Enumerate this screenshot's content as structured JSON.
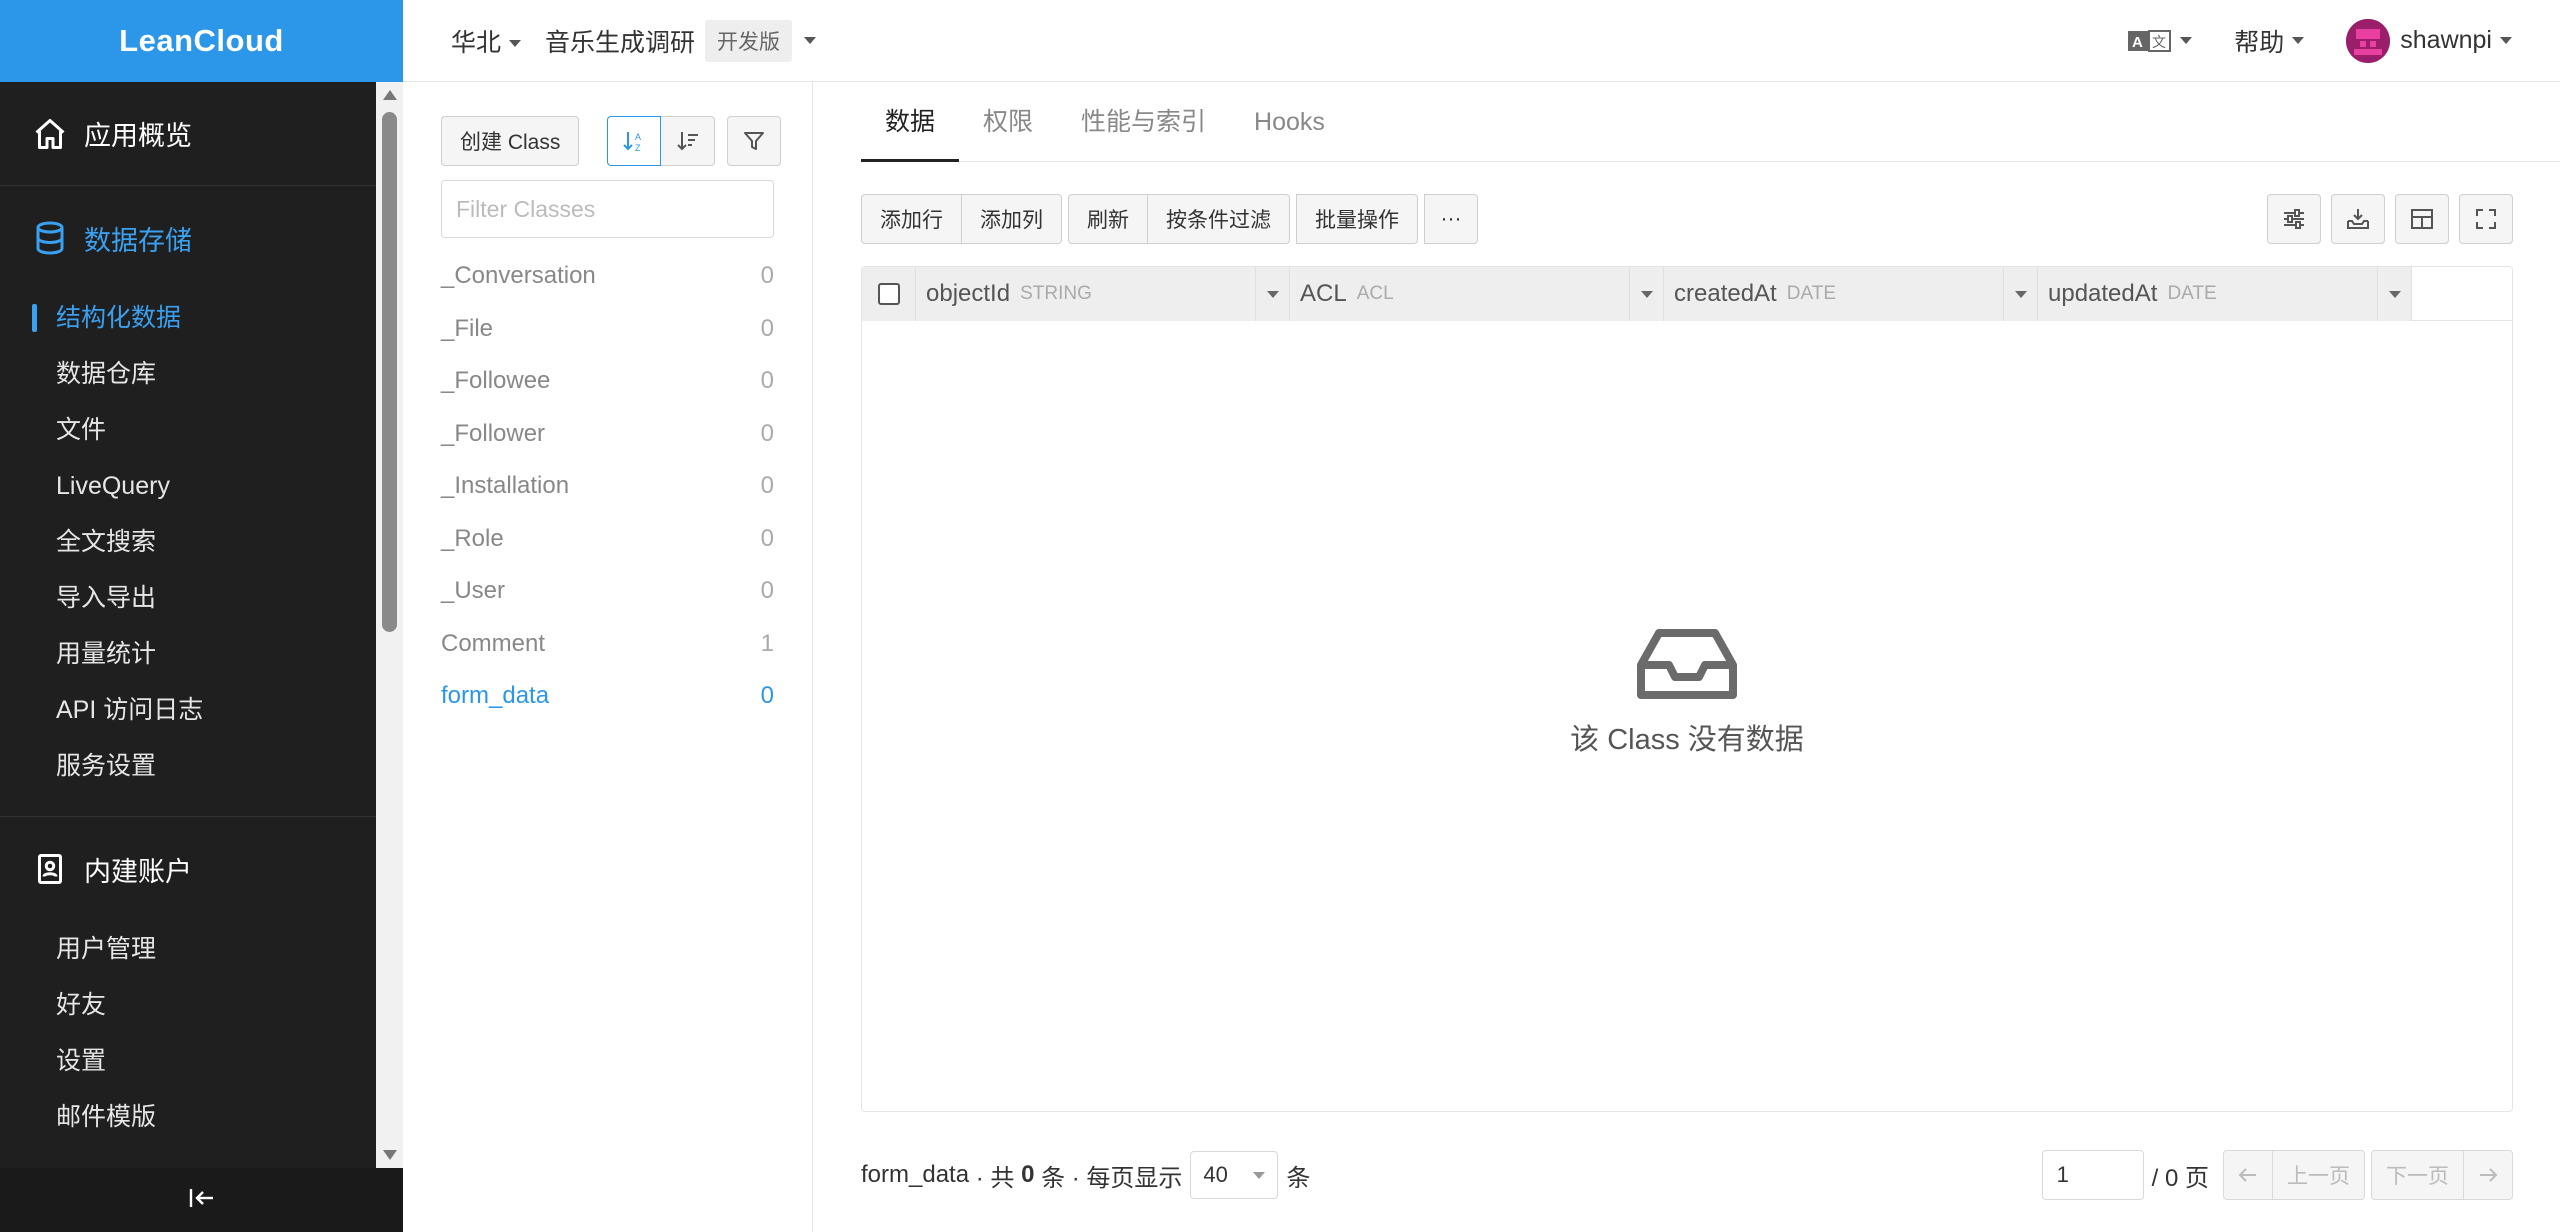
{
  "brand": "LeanCloud",
  "sidebar": {
    "overview": "应用概览",
    "storage": "数据存储",
    "storage_items": [
      {
        "label": "结构化数据"
      },
      {
        "label": "数据仓库"
      },
      {
        "label": "文件"
      },
      {
        "label": "LiveQuery"
      },
      {
        "label": "全文搜索"
      },
      {
        "label": "导入导出"
      },
      {
        "label": "用量统计"
      },
      {
        "label": "API 访问日志"
      },
      {
        "label": "服务设置"
      }
    ],
    "accounts": "内建账户",
    "account_items": [
      {
        "label": "用户管理"
      },
      {
        "label": "好友"
      },
      {
        "label": "设置"
      },
      {
        "label": "邮件模版"
      }
    ]
  },
  "topbar": {
    "region": "华北",
    "app_name": "音乐生成调研",
    "plan": "开发版",
    "help": "帮助",
    "user": "shawnpi"
  },
  "classes": {
    "create_label": "创建 Class",
    "filter_placeholder": "Filter Classes",
    "items": [
      {
        "name": "_Conversation",
        "count": "0"
      },
      {
        "name": "_File",
        "count": "0"
      },
      {
        "name": "_Followee",
        "count": "0"
      },
      {
        "name": "_Follower",
        "count": "0"
      },
      {
        "name": "_Installation",
        "count": "0"
      },
      {
        "name": "_Role",
        "count": "0"
      },
      {
        "name": "_User",
        "count": "0"
      },
      {
        "name": "Comment",
        "count": "1"
      },
      {
        "name": "form_data",
        "count": "0"
      }
    ]
  },
  "tabs": [
    "数据",
    "权限",
    "性能与索引",
    "Hooks"
  ],
  "actions": {
    "add_row": "添加行",
    "add_col": "添加列",
    "refresh": "刷新",
    "filter": "按条件过滤",
    "batch": "批量操作",
    "more": "···"
  },
  "columns": [
    {
      "name": "objectId",
      "type": "STRING"
    },
    {
      "name": "ACL",
      "type": "ACL"
    },
    {
      "name": "createdAt",
      "type": "DATE"
    },
    {
      "name": "updatedAt",
      "type": "DATE"
    }
  ],
  "empty_text": "该 Class 没有数据",
  "footer": {
    "class_name": "form_data",
    "sep1": " · 共 ",
    "total": "0",
    "sep2": " 条 · 每页显示",
    "page_size": "40",
    "unit": "条",
    "page_value": "1",
    "page_total": "/ 0 页",
    "prev": "上一页",
    "next": "下一页"
  },
  "colors": {
    "accent": "#2c97e8",
    "sidebar_bg": "#1f1f1f"
  }
}
